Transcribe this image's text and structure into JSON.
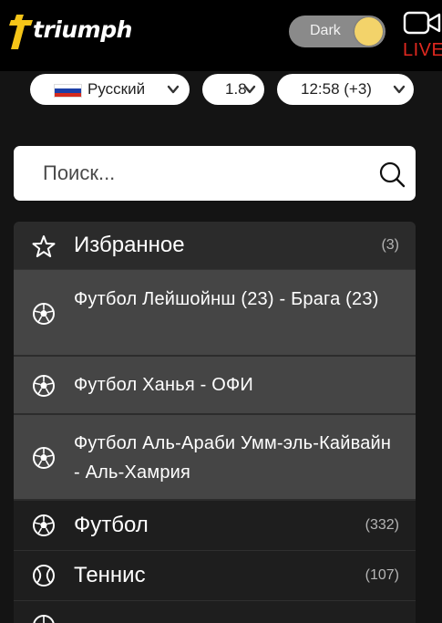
{
  "header": {
    "logo_text": "triumph",
    "theme_toggle_label": "Dark",
    "live_label": "LIVE",
    "colors": {
      "header_bg": "#000000",
      "accent_yellow": "#f5c518",
      "live_red": "#e0281f",
      "toggle_knob": "#f3d36a"
    }
  },
  "settings": {
    "language": {
      "flag": "ru-flag-icon",
      "label": "Русский"
    },
    "odds_format": {
      "label": "1.8"
    },
    "time": {
      "label": "12:58 (+3)"
    }
  },
  "search": {
    "placeholder": "Поиск...",
    "value": ""
  },
  "sports_list": {
    "favorites": {
      "label": "Избранное",
      "count": "(3)",
      "icon": "star-icon"
    },
    "favorite_matches": [
      {
        "icon": "football-icon",
        "label": "Футбол Лейшойнш (23) - Брага (23)"
      },
      {
        "icon": "football-icon",
        "label": "Футбол Ханья - ОФИ"
      },
      {
        "icon": "football-icon",
        "label": "Футбол Аль-Араби Умм-эль-Кайвайн - Аль-Хамрия"
      }
    ],
    "sports": [
      {
        "icon": "football-icon",
        "label": "Футбол",
        "count": "(332)"
      },
      {
        "icon": "tennis-icon",
        "label": "Теннис",
        "count": "(107)"
      }
    ]
  }
}
